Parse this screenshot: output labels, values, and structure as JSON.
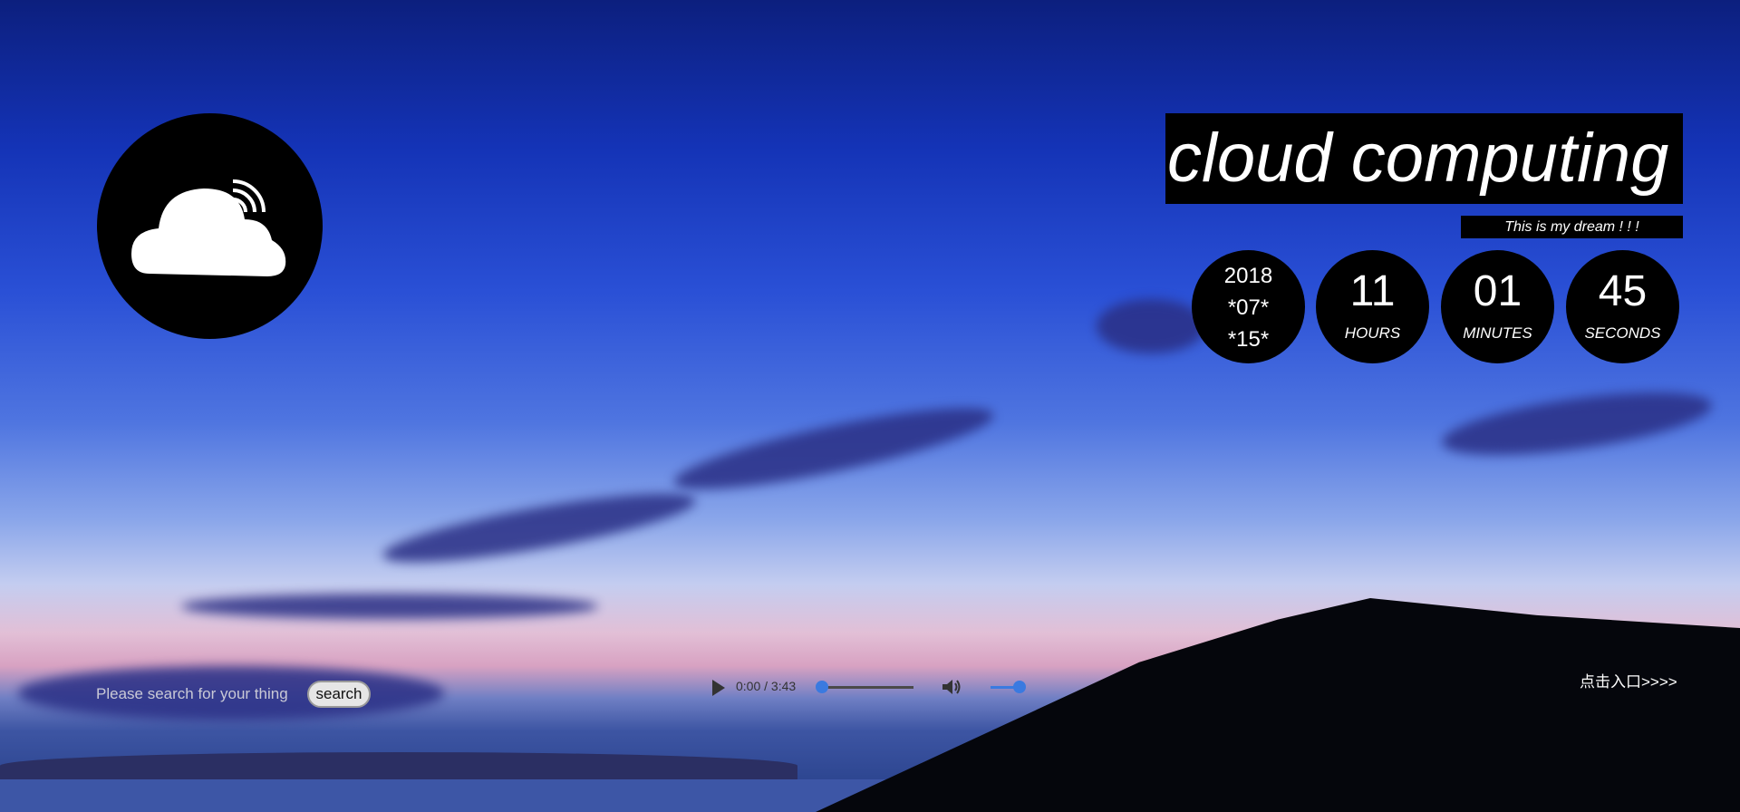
{
  "page": {
    "title": "cloud computing",
    "subtitle": "This is my dream ! ! !"
  },
  "logo": {
    "icon": "cloud-signal-icon"
  },
  "clock": {
    "date": {
      "year": "2018",
      "month": "*07*",
      "day": "*15*"
    },
    "hours": {
      "value": "11",
      "label": "HOURS"
    },
    "minutes": {
      "value": "01",
      "label": "MINUTES"
    },
    "seconds": {
      "value": "45",
      "label": "SECONDS"
    }
  },
  "search": {
    "placeholder": "Please search for your thing",
    "button_label": "search"
  },
  "player": {
    "current_time": "0:00",
    "duration": "3:43",
    "time_display": "0:00 / 3:43",
    "progress": 0,
    "volume": 1.0
  },
  "entry": {
    "label": "点击入口>>>>"
  },
  "colors": {
    "accent": "#3a7ae0",
    "panel": "#000000",
    "text": "#ffffff"
  }
}
